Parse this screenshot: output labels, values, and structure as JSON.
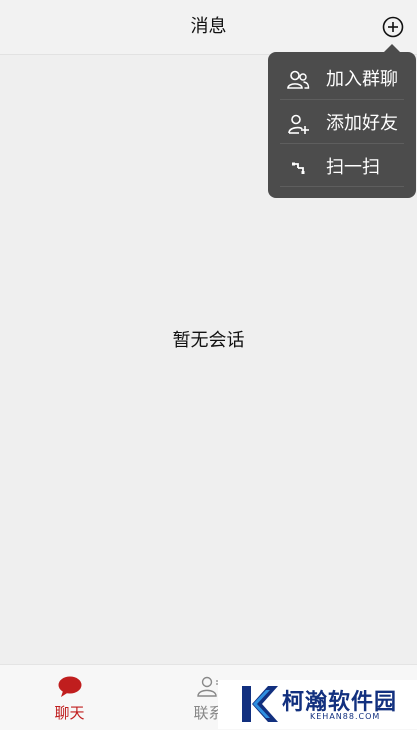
{
  "header": {
    "title": "消息"
  },
  "popup_menu": {
    "items": [
      {
        "label": "加入群聊",
        "icon": "group-icon"
      },
      {
        "label": "添加好友",
        "icon": "add-friend-icon"
      },
      {
        "label": "扫一扫",
        "icon": "scan-icon"
      }
    ]
  },
  "main": {
    "empty_text": "暂无会话"
  },
  "tabbar": {
    "tabs": [
      {
        "label": "聊天",
        "icon": "chat-bubble-icon",
        "active": true
      },
      {
        "label": "联系",
        "icon": "contacts-icon",
        "active": false
      }
    ]
  },
  "watermark": {
    "name": "柯瀚软件园",
    "domain": "KEHAN88.COM"
  },
  "colors": {
    "accent": "#c01e1e",
    "menu_bg": "#4c4c4c",
    "brand": "#12307f"
  }
}
